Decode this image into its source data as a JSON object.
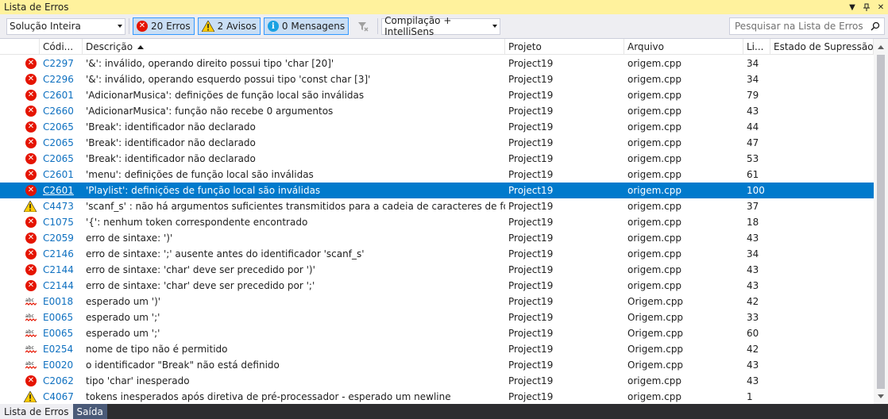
{
  "window": {
    "title": "Lista de Erros"
  },
  "toolbar": {
    "scope": "Solução Inteira",
    "errors_label": "20 Erros",
    "warnings_label": "2 Avisos",
    "messages_label": "0 Mensagens",
    "build_filter": "Compilação + IntelliSens",
    "search_placeholder": "Pesquisar na Lista de Erros"
  },
  "columns": {
    "code": "Códi...",
    "description": "Descrição",
    "project": "Projeto",
    "file": "Arquivo",
    "line": "Li...",
    "suppression": "Estado de Supressão"
  },
  "rows": [
    {
      "type": "error",
      "code": "C2297",
      "description": "'&': inválido, operando direito possui tipo 'char [20]'",
      "project": "Project19",
      "file": "origem.cpp",
      "line": "34"
    },
    {
      "type": "error",
      "code": "C2296",
      "description": "'&': inválido, operando esquerdo possui tipo 'const char [3]'",
      "project": "Project19",
      "file": "origem.cpp",
      "line": "34"
    },
    {
      "type": "error",
      "code": "C2601",
      "description": "'AdicionarMusica': definições de função local são inválidas",
      "project": "Project19",
      "file": "origem.cpp",
      "line": "79"
    },
    {
      "type": "error",
      "code": "C2660",
      "description": "'AdicionarMusica': função não recebe 0 argumentos",
      "project": "Project19",
      "file": "origem.cpp",
      "line": "43"
    },
    {
      "type": "error",
      "code": "C2065",
      "description": "'Break': identificador não declarado",
      "project": "Project19",
      "file": "origem.cpp",
      "line": "44"
    },
    {
      "type": "error",
      "code": "C2065",
      "description": "'Break': identificador não declarado",
      "project": "Project19",
      "file": "origem.cpp",
      "line": "47"
    },
    {
      "type": "error",
      "code": "C2065",
      "description": "'Break': identificador não declarado",
      "project": "Project19",
      "file": "origem.cpp",
      "line": "53"
    },
    {
      "type": "error",
      "code": "C2601",
      "description": "'menu': definições de função local são inválidas",
      "project": "Project19",
      "file": "origem.cpp",
      "line": "61"
    },
    {
      "type": "error",
      "code": "C2601",
      "description": "'Playlist': definições de função local são inválidas",
      "project": "Project19",
      "file": "origem.cpp",
      "line": "100",
      "selected": true
    },
    {
      "type": "warning",
      "code": "C4473",
      "description": "'scanf_s' : não há argumentos suficientes transmitidos para a cadeia de caracteres de formato",
      "project": "Project19",
      "file": "origem.cpp",
      "line": "37"
    },
    {
      "type": "error",
      "code": "C1075",
      "description": "'{': nenhum token correspondente encontrado",
      "project": "Project19",
      "file": "origem.cpp",
      "line": "18"
    },
    {
      "type": "error",
      "code": "C2059",
      "description": "erro de sintaxe: ')'",
      "project": "Project19",
      "file": "origem.cpp",
      "line": "43"
    },
    {
      "type": "error",
      "code": "C2146",
      "description": "erro de sintaxe: ';' ausente antes do identificador 'scanf_s'",
      "project": "Project19",
      "file": "origem.cpp",
      "line": "34"
    },
    {
      "type": "error",
      "code": "C2144",
      "description": "erro de sintaxe: 'char' deve ser precedido por ')'",
      "project": "Project19",
      "file": "origem.cpp",
      "line": "43"
    },
    {
      "type": "error",
      "code": "C2144",
      "description": "erro de sintaxe: 'char' deve ser precedido por ';'",
      "project": "Project19",
      "file": "origem.cpp",
      "line": "43"
    },
    {
      "type": "intellisense",
      "code": "E0018",
      "description": "esperado um ')'",
      "project": "Project19",
      "file": "Origem.cpp",
      "line": "42"
    },
    {
      "type": "intellisense",
      "code": "E0065",
      "description": "esperado um ';'",
      "project": "Project19",
      "file": "Origem.cpp",
      "line": "33"
    },
    {
      "type": "intellisense",
      "code": "E0065",
      "description": "esperado um ';'",
      "project": "Project19",
      "file": "Origem.cpp",
      "line": "60"
    },
    {
      "type": "intellisense",
      "code": "E0254",
      "description": "nome de tipo não é permitido",
      "project": "Project19",
      "file": "Origem.cpp",
      "line": "42"
    },
    {
      "type": "intellisense",
      "code": "E0020",
      "description": "o identificador \"Break\" não está definido",
      "project": "Project19",
      "file": "Origem.cpp",
      "line": "43"
    },
    {
      "type": "error",
      "code": "C2062",
      "description": "tipo 'char' inesperado",
      "project": "Project19",
      "file": "origem.cpp",
      "line": "43"
    },
    {
      "type": "warning",
      "code": "C4067",
      "description": "tokens inesperados após diretiva de pré-processador - esperado um newline",
      "project": "Project19",
      "file": "origem.cpp",
      "line": "1"
    }
  ],
  "bottom_tabs": [
    {
      "label": "Lista de Erros"
    },
    {
      "label": "Saída"
    }
  ],
  "colors": {
    "title_bg": "#fff29d",
    "selection": "#007acc",
    "error": "#e51400",
    "warning": "#ffcc00",
    "info": "#1ba1e2",
    "link": "#0e70c0"
  },
  "icons": {
    "error": "error-icon",
    "warning": "warning-icon",
    "intellisense": "intellisense-squiggle-icon",
    "info": "info-icon"
  }
}
